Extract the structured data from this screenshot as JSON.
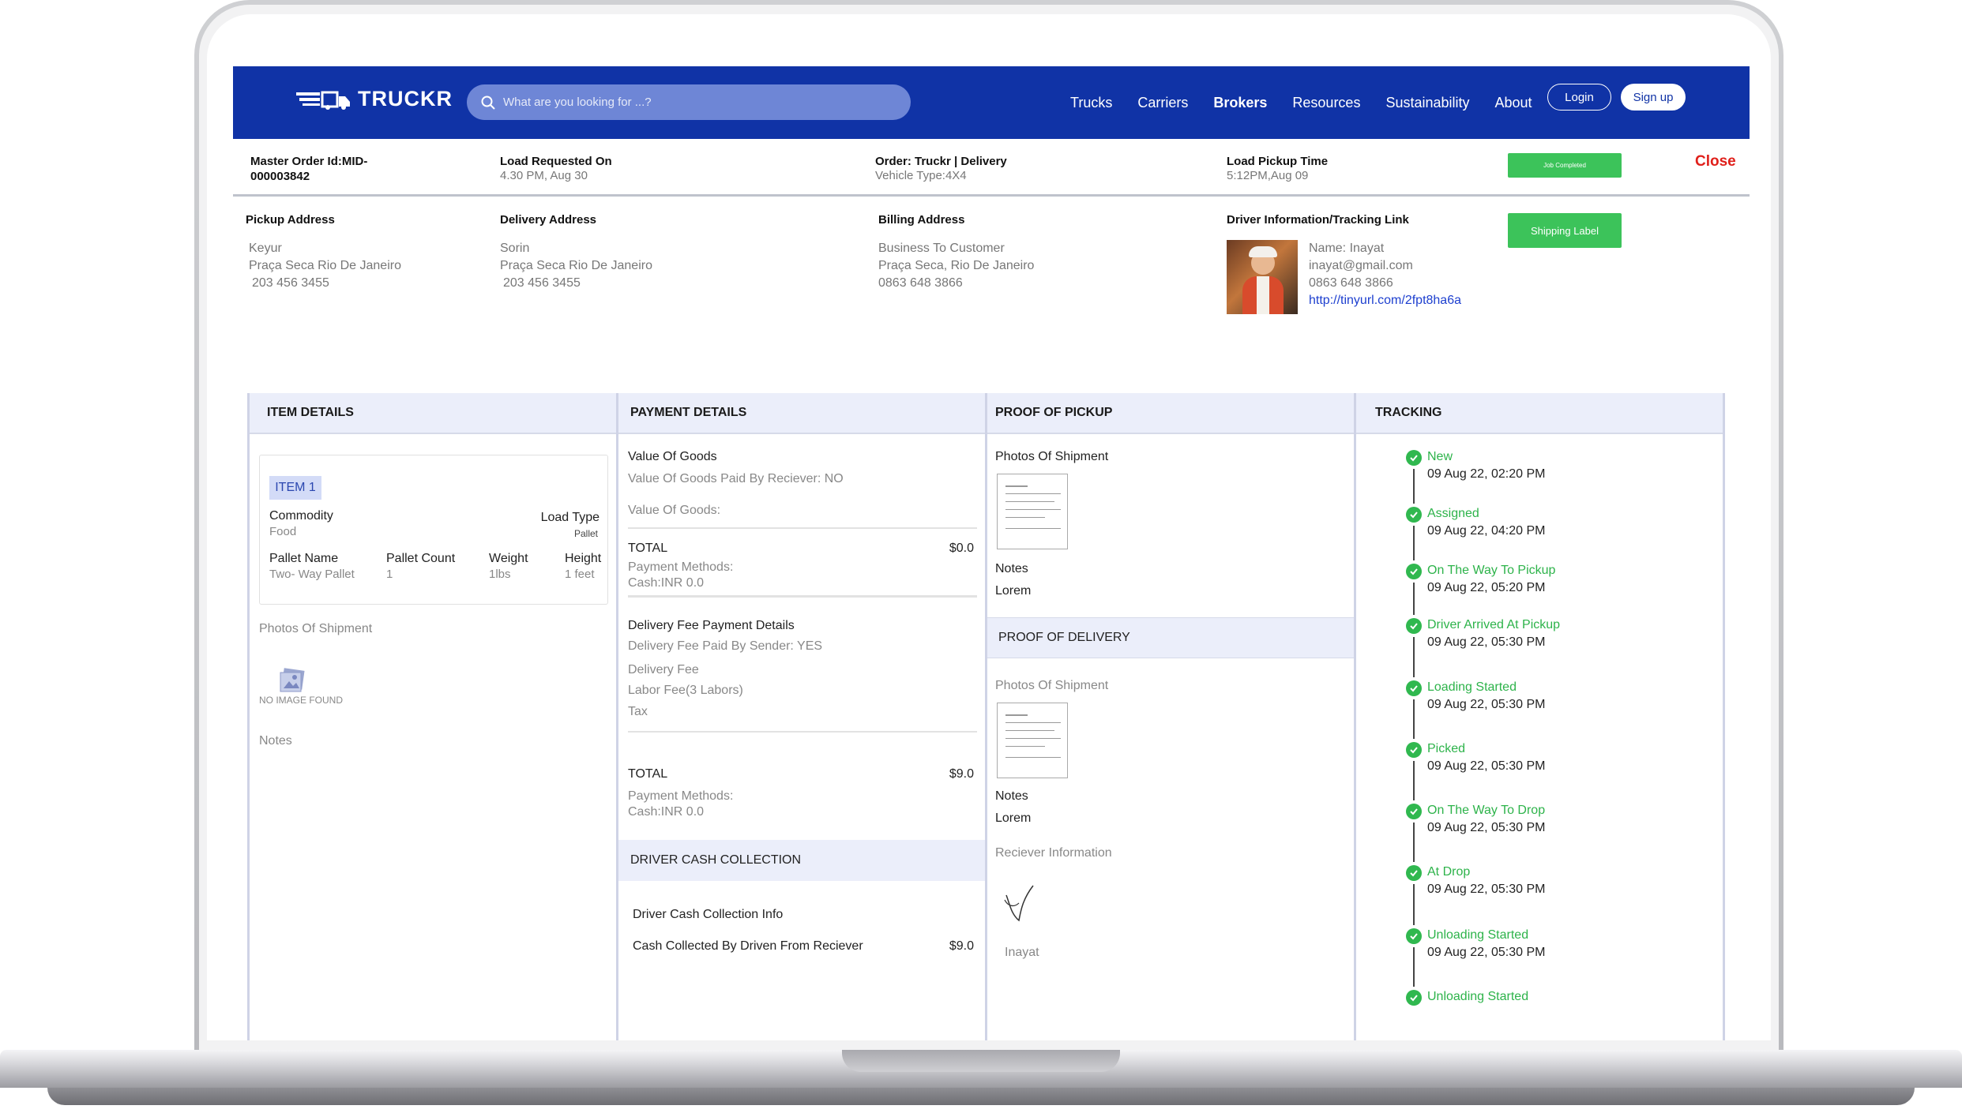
{
  "nav": {
    "logo": "TRUCKR",
    "search_placeholder": "What are you looking for ...?",
    "links": [
      "Trucks",
      "Carriers",
      "Brokers",
      "Resources",
      "Sustainability",
      "About"
    ],
    "login": "Login",
    "signup": "Sign up"
  },
  "order": {
    "master_label": "Master Order Id:MID-",
    "master_value": "000003842",
    "requested_label": "Load Requested On",
    "requested_value": "4.30 PM, Aug 30",
    "order_label": "Order: Truckr | Delivery",
    "vehicle": "Vehicle Type:4X4",
    "pickup_time_label": "Load Pickup Time",
    "pickup_time_value": "5:12PM,Aug 09",
    "status_button": "Job Completed",
    "close": "Close"
  },
  "addresses": {
    "pickup_label": "Pickup Address",
    "pickup": [
      "Keyur",
      "Praça Seca Rio De Janeiro",
      "203 456 3455"
    ],
    "delivery_label": "Delivery Address",
    "delivery": [
      "Sorin",
      "Praça Seca Rio De Janeiro",
      "203 456 3455"
    ],
    "billing_label": "Billing Address",
    "billing": [
      "Business To Customer",
      "Praça Seca, Rio De Janeiro",
      "0863 648 3866"
    ],
    "driver_label": "Driver Information/Tracking Link",
    "driver_name": "Name: Inayat",
    "driver_email": "inayat@gmail.com",
    "driver_phone": "0863 648 3866",
    "driver_link": "http://tinyurl.com/2fpt8ha6a",
    "shipping_button": "Shipping Label"
  },
  "item_details": {
    "header": "ITEM  DETAILS",
    "badge": "ITEM 1",
    "commodity_label": "Commodity",
    "commodity_value": "Food",
    "load_type_label": "Load Type",
    "load_type_value": "Pallet",
    "pallet_name_label": "Pallet Name",
    "pallet_name_value": "Two- Way Pallet",
    "pallet_count_label": "Pallet Count",
    "pallet_count_value": "1",
    "weight_label": "Weight",
    "weight_value": "1lbs",
    "height_label": "Height",
    "height_value": "1 feet",
    "photos_label": "Photos Of Shipment",
    "no_image": "NO IMAGE FOUND",
    "notes": "Notes"
  },
  "payment": {
    "header": "PAYMENT DETAILS",
    "vog_title": "Value Of Goods",
    "vog_paid": "Value Of Goods Paid By Reciever: NO",
    "vog_label": "Value Of Goods:",
    "total_label": "TOTAL",
    "total1": "$0.0",
    "methods_label": "Payment Methods:",
    "methods_value": "Cash:INR 0.0",
    "fee_title": "Delivery Fee Payment Details",
    "fee_paid": "Delivery Fee Paid By Sender: YES",
    "fee": "Delivery Fee",
    "labor": "Labor Fee(3 Labors)",
    "tax": "Tax",
    "total2": "$9.0",
    "methods2_value": "Cash:INR 0.0",
    "cash_header": "DRIVER CASH COLLECTION",
    "cash_info": "Driver Cash Collection Info",
    "cash_collected": "Cash Collected By Driven From Reciever",
    "cash_value": "$9.0"
  },
  "proof": {
    "header": "PROOF OF PICKUP",
    "photos": "Photos Of Shipment",
    "notes": "Notes",
    "notes_value": "Lorem",
    "delivery_header": "PROOF OF DELIVERY",
    "delivery_photos": "Photos Of Shipment",
    "delivery_notes": "Notes",
    "delivery_notes_value": "Lorem",
    "receiver": "Reciever Information",
    "receiver_name": "Inayat"
  },
  "tracking": {
    "header": "TRACKING",
    "steps": [
      {
        "status": "New",
        "date": "09 Aug 22, 02:20 PM"
      },
      {
        "status": "Assigned",
        "date": "09 Aug 22, 04:20 PM"
      },
      {
        "status": "On The Way To Pickup",
        "date": "09 Aug 22, 05:20 PM"
      },
      {
        "status": "Driver Arrived At Pickup",
        "date": "09 Aug 22, 05:30 PM"
      },
      {
        "status": "Loading Started",
        "date": "09 Aug 22, 05:30 PM"
      },
      {
        "status": "Picked",
        "date": "09 Aug 22, 05:30 PM"
      },
      {
        "status": "On The Way To Drop",
        "date": "09 Aug 22, 05:30 PM"
      },
      {
        "status": "At Drop",
        "date": "09 Aug 22, 05:30 PM"
      },
      {
        "status": "Unloading Started",
        "date": "09 Aug 22, 05:30 PM"
      },
      {
        "status": "Unloading Started",
        "date": ""
      }
    ]
  },
  "colors": {
    "brand": "#1033a6",
    "success": "#30b84f",
    "danger": "#e0201b",
    "link": "#1d3fcf"
  }
}
